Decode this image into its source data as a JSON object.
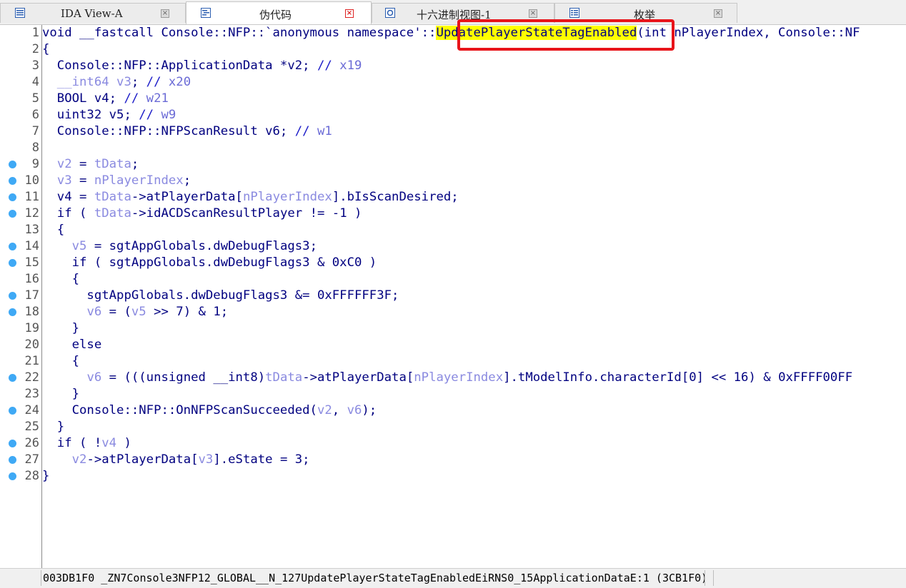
{
  "tabs": [
    {
      "label": "IDA View-A",
      "icon": "disassembly-view-icon",
      "active": false
    },
    {
      "label": "伪代码",
      "icon": "pseudocode-icon",
      "active": true
    },
    {
      "label": "十六进制视图-1",
      "icon": "hex-view-icon",
      "active": false
    },
    {
      "label": "枚举",
      "icon": "enums-icon",
      "active": false
    }
  ],
  "tab_close_glyph": "×",
  "code_lines": [
    {
      "n": "1",
      "bp": false
    },
    {
      "n": "2",
      "bp": false
    },
    {
      "n": "3",
      "bp": false
    },
    {
      "n": "4",
      "bp": false
    },
    {
      "n": "5",
      "bp": false
    },
    {
      "n": "6",
      "bp": false
    },
    {
      "n": "7",
      "bp": false
    },
    {
      "n": "8",
      "bp": false
    },
    {
      "n": "9",
      "bp": true
    },
    {
      "n": "10",
      "bp": true
    },
    {
      "n": "11",
      "bp": true
    },
    {
      "n": "12",
      "bp": true
    },
    {
      "n": "13",
      "bp": false
    },
    {
      "n": "14",
      "bp": true
    },
    {
      "n": "15",
      "bp": true
    },
    {
      "n": "16",
      "bp": false
    },
    {
      "n": "17",
      "bp": true
    },
    {
      "n": "18",
      "bp": true
    },
    {
      "n": "19",
      "bp": false
    },
    {
      "n": "20",
      "bp": false
    },
    {
      "n": "21",
      "bp": false
    },
    {
      "n": "22",
      "bp": true
    },
    {
      "n": "23",
      "bp": false
    },
    {
      "n": "24",
      "bp": true
    },
    {
      "n": "25",
      "bp": false
    },
    {
      "n": "26",
      "bp": true
    },
    {
      "n": "27",
      "bp": true
    },
    {
      "n": "28",
      "bp": true
    }
  ],
  "code": {
    "l1a": "void __fastcall Console::NFP::`anonymous namespace'::",
    "l1hl": "UpdatePlayerStateTagEnabled",
    "l1b": "(int nPlayerIndex, Console::NF",
    "l2": "{",
    "l3a": "  Console::NFP::ApplicationData *v2; ",
    "l3c": "// ",
    "l3r": "x19",
    "l4a": "  __int64 ",
    "l4v": "v3",
    "l4b": "; ",
    "l4c": "// ",
    "l4r": "x20",
    "l5a": "  BOOL v4; ",
    "l5c": "// ",
    "l5r": "w21",
    "l6a": "  uint32 v5; ",
    "l6c": "// ",
    "l6r": "w9",
    "l7a": "  Console::NFP::NFPScanResult v6; ",
    "l7c": "// ",
    "l7r": "w1",
    "l8": "",
    "l9a": "  ",
    "l9v1": "v2",
    "l9b": " = ",
    "l9v2": "tData",
    "l9c": ";",
    "l10a": "  ",
    "l10v1": "v3",
    "l10b": " = ",
    "l10v2": "nPlayerIndex",
    "l10c": ";",
    "l11a": "  v4 = ",
    "l11v1": "tData",
    "l11b": "->atPlayerData[",
    "l11v2": "nPlayerIndex",
    "l11c": "].bIsScanDesired;",
    "l12a": "  if ( ",
    "l12v": "tData",
    "l12b": "->idACDScanResultPlayer != -1 )",
    "l13": "  {",
    "l14a": "    ",
    "l14v": "v5",
    "l14b": " = sgtAppGlobals.dwDebugFlags3;",
    "l15": "    if ( sgtAppGlobals.dwDebugFlags3 & 0xC0 )",
    "l16": "    {",
    "l17": "      sgtAppGlobals.dwDebugFlags3 &= 0xFFFFFF3F;",
    "l18a": "      ",
    "l18v1": "v6",
    "l18b": " = (",
    "l18v2": "v5",
    "l18c": " >> 7) & 1;",
    "l19": "    }",
    "l20": "    else",
    "l21": "    {",
    "l22a": "      ",
    "l22v1": "v6",
    "l22b": " = (((unsigned __int8)",
    "l22v2": "tData",
    "l22c": "->atPlayerData[",
    "l22v3": "nPlayerIndex",
    "l22d": "].tModelInfo.characterId[0] << 16) & 0xFFFF00FF",
    "l23": "    }",
    "l24a": "    Console::NFP::OnNFPScanSucceeded(",
    "l24v1": "v2",
    "l24b": ", ",
    "l24v2": "v6",
    "l24c": ");",
    "l25": "  }",
    "l26a": "  if ( !",
    "l26v": "v4",
    "l26b": " )",
    "l27a": "    ",
    "l27v1": "v2",
    "l27b": "->atPlayerData[",
    "l27v2": "v3",
    "l27c": "].eState = 3;",
    "l28": "}"
  },
  "status": {
    "text": "003DB1F0 _ZN7Console3NFP12_GLOBAL__N_127UpdatePlayerStateTagEnabledEiRNS0_15ApplicationDataE:1 (3CB1F0)"
  },
  "colors": {
    "highlight": "#ffff00",
    "annotation_box": "#e8141a",
    "breakpoint_dot": "#3fa9f5",
    "code_text": "#000080",
    "variable": "#8a8ae0"
  }
}
